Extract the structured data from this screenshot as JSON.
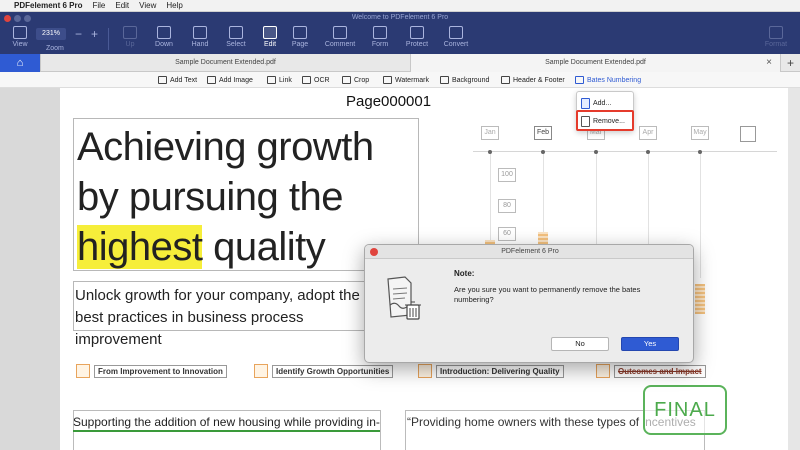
{
  "menubar": {
    "app_name": "PDFelement 6 Pro",
    "items": [
      "File",
      "Edit",
      "View",
      "Help"
    ]
  },
  "toolbar": {
    "window_title": "Welcome to PDFelement 6 Pro",
    "zoom_value": "231%",
    "zoom_label": "Zoom",
    "items": {
      "view": "View",
      "up": "Up",
      "down": "Down",
      "hand": "Hand",
      "select": "Select",
      "edit": "Edit",
      "page": "Page",
      "comment": "Comment",
      "form": "Form",
      "protect": "Protect",
      "convert": "Convert",
      "format": "Format"
    },
    "zoom_minus": "−",
    "zoom_plus": "+"
  },
  "tabs": {
    "home_icon": "⌂",
    "tab1": "Sample Document Extended.pdf",
    "tab2": "Sample Document Extended.pdf",
    "close": "×",
    "add": "+"
  },
  "edit_bar": {
    "add_text": "Add Text",
    "add_image": "Add Image",
    "link": "Link",
    "ocr": "OCR",
    "crop": "Crop",
    "watermark": "Watermark",
    "background": "Background",
    "header_footer": "Header & Footer",
    "bates_numbering": "Bates Numbering"
  },
  "bates_menu": {
    "add": "Add...",
    "remove": "Remove..."
  },
  "document": {
    "page_number": "Page000001",
    "headline_1": "Achieving growth",
    "headline_2": "by pursuing the",
    "headline_3_highlight": "highest",
    "headline_3_rest": " quality",
    "subheadline": "Unlock growth for your company, adopt the best practices in business process improvement",
    "sections": [
      "From Improvement to Innovation",
      "Identify Growth Opportunities",
      "Introduction: Delivering Quality",
      "Outcomes and Impact"
    ],
    "para_left": "Supporting the addition of new housing while providing in-",
    "para_right": "“Providing home owners with these types of incentives",
    "stamp": "FINAL"
  },
  "chart": {
    "months": [
      "Jan",
      "Feb",
      "Mar",
      "Apr",
      "May"
    ],
    "yticks": [
      "100",
      "80",
      "60"
    ]
  },
  "dialog": {
    "title": "PDFelement 6 Pro",
    "note": "Note:",
    "message": "Are you sure you want to permanently remove the bates numbering?",
    "no_button": "No",
    "yes_button": "Yes"
  },
  "colors": {
    "toolbar_bg": "#2b3a73",
    "accent_blue": "#2f5bd3",
    "highlight_yellow": "#f6ee3a",
    "callout_red": "#e53b2c",
    "stamp_green": "#4caa4c"
  }
}
